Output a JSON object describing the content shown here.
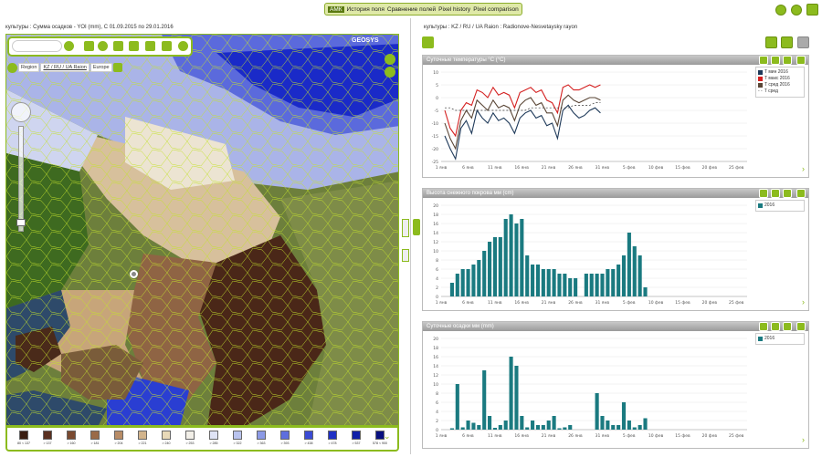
{
  "top_tabs": [
    "АМК",
    "История поля",
    "Сравнение полей",
    "Pixel history",
    "Pixel comparison"
  ],
  "map_title": "культуры : Сумма осадков - YOI (mm), C 01.09.2015 по 29.01.2016",
  "right_title": "культуры : KZ / RU / UA Raion : Radionove-Nesvetaysky rayon",
  "search": {
    "placeholder": ""
  },
  "brand": "GEOSYS",
  "breadcrumb": [
    "Region",
    "KZ / RU / UA Raion",
    "Europe"
  ],
  "legend_labels": [
    "80 < 137",
    "> 137",
    "> 160",
    "> 181",
    "> 204",
    "> 221",
    "> 240",
    "> 253",
    "> 285",
    "> 322",
    "> 363",
    "> 393",
    "> 438",
    "> 478",
    "> 537",
    "578 < 900"
  ],
  "legend_colors": [
    "#3a1e12",
    "#5a3020",
    "#7a4a30",
    "#9a6a48",
    "#b88c66",
    "#d2b48c",
    "#e8d9b8",
    "#f2efe8",
    "#dfe3f5",
    "#b9c3ee",
    "#8c9ae6",
    "#5e6ede",
    "#3b4bd4",
    "#2030c4",
    "#1020a8",
    "#081080"
  ],
  "panels": [
    {
      "title": "Суточные температуры °C (°C)",
      "legend": [
        {
          "name": "T мин 2016",
          "color": "#1f3a5a"
        },
        {
          "name": "T макс 2016",
          "color": "#d42020"
        },
        {
          "name": "T сред 2016",
          "color": "#5a4636"
        },
        {
          "name": "T сред",
          "color": "#333333"
        }
      ]
    },
    {
      "title": "Высота снежного покрова мм (cm)",
      "legend": [
        {
          "name": "2016",
          "color": "#1a7a80"
        }
      ]
    },
    {
      "title": "Суточные осадки мм (mm)",
      "legend": [
        {
          "name": "2016",
          "color": "#1a7a80"
        }
      ]
    }
  ],
  "chart_data": [
    {
      "type": "line",
      "title": "Суточные температуры °C (°C)",
      "x": [
        "1 янв",
        "6 янв",
        "11 янв",
        "16 янв",
        "21 янв",
        "26 янв",
        "31 янв",
        "5 фев",
        "10 фев",
        "15 фев",
        "20 фев",
        "25 фев"
      ],
      "y_ticks": [
        10,
        5,
        0,
        -5,
        -10,
        -15,
        -20,
        -25
      ],
      "series": [
        {
          "name": "T мин 2016",
          "color": "#1f3a5a",
          "values": [
            -15,
            -20,
            -24,
            -12,
            -9,
            -14,
            -5,
            -8,
            -10,
            -6,
            -9,
            -8,
            -10,
            -14,
            -8,
            -6,
            -5,
            -8,
            -7,
            -11,
            -10,
            -16,
            -5,
            -3,
            -6,
            -8,
            -7,
            -5,
            -4,
            -6
          ]
        },
        {
          "name": "T макс 2016",
          "color": "#d42020",
          "values": [
            -5,
            -12,
            -15,
            -5,
            -2,
            -3,
            3,
            2,
            0,
            4,
            1,
            2,
            1,
            -4,
            2,
            3,
            4,
            2,
            3,
            -1,
            -2,
            -6,
            4,
            5,
            3,
            3,
            4,
            5,
            4,
            5
          ]
        },
        {
          "name": "T сред 2016",
          "color": "#5a4636",
          "values": [
            -10,
            -16,
            -20,
            -9,
            -5,
            -8,
            -1,
            -3,
            -5,
            -1,
            -4,
            -3,
            -4,
            -9,
            -3,
            -1,
            0,
            -3,
            -2,
            -6,
            -6,
            -11,
            -1,
            1,
            -1,
            -2,
            -1,
            0,
            0,
            -1
          ]
        },
        {
          "name": "T сред",
          "color": "#333333",
          "values": [
            -4,
            -4,
            -5,
            -5,
            -5,
            -5,
            -5,
            -5,
            -5,
            -5,
            -5,
            -5,
            -5,
            -5,
            -5,
            -5,
            -4,
            -4,
            -4,
            -4,
            -4,
            -4,
            -4,
            -4,
            -3,
            -3,
            -3,
            -3,
            -2,
            -2
          ]
        }
      ],
      "ylim": [
        -25,
        10
      ]
    },
    {
      "type": "bar",
      "title": "Высота снежного покрова мм (cm)",
      "x": [
        "1 янв",
        "6 янв",
        "11 янв",
        "16 янв",
        "21 янв",
        "26 янв",
        "31 янв",
        "5 фев",
        "10 фев",
        "15 фев",
        "20 фев",
        "25 фев"
      ],
      "y_ticks": [
        20,
        18,
        16,
        14,
        12,
        10,
        8,
        6,
        4,
        2,
        0
      ],
      "series": [
        {
          "name": "2016",
          "color": "#1a7a80",
          "values": [
            0,
            3,
            5,
            6,
            6,
            7,
            8,
            10,
            12,
            13,
            13,
            17,
            18,
            16,
            17,
            9,
            7,
            7,
            6,
            6,
            6,
            5,
            5,
            4,
            4,
            0,
            5,
            5,
            5,
            5,
            6,
            6,
            7,
            9,
            14,
            11,
            9,
            2
          ]
        }
      ],
      "ylim": [
        0,
        20
      ]
    },
    {
      "type": "bar",
      "title": "Суточные осадки мм (mm)",
      "x": [
        "1 янв",
        "6 янв",
        "11 янв",
        "16 янв",
        "21 янв",
        "26 янв",
        "31 янв",
        "5 фев",
        "10 фев",
        "15 фев",
        "20 фев",
        "25 фев"
      ],
      "y_ticks": [
        20,
        18,
        16,
        14,
        12,
        10,
        8,
        6,
        4,
        2,
        0
      ],
      "series": [
        {
          "name": "2016",
          "color": "#1a7a80",
          "values": [
            0,
            0.3,
            10,
            0.5,
            2,
            1.5,
            1,
            13,
            3,
            0.4,
            1,
            2,
            16,
            14,
            3,
            0.5,
            2,
            1,
            1,
            2,
            3,
            0.3,
            0.5,
            1,
            0,
            0,
            0,
            0,
            8,
            3,
            2,
            1,
            1,
            6,
            2,
            0.5,
            1,
            2.5
          ]
        }
      ],
      "ylim": [
        0,
        20
      ]
    }
  ]
}
